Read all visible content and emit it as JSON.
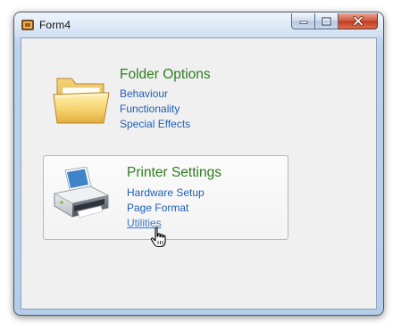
{
  "window": {
    "title": "Form4"
  },
  "folder_options": {
    "title": "Folder Options",
    "icon": "folder-icon",
    "links": [
      "Behaviour",
      "Functionality",
      "Special Effects"
    ]
  },
  "printer_settings": {
    "title": "Printer Settings",
    "icon": "printer-icon",
    "links": [
      "Hardware Setup",
      "Page Format",
      "Utilities"
    ]
  },
  "colors": {
    "group_title": "#2e7d1f",
    "link": "#1f5fb4"
  }
}
